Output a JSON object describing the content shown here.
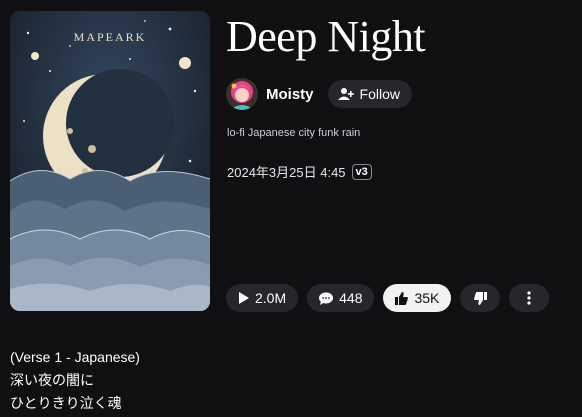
{
  "song": {
    "title": "Deep Night",
    "cover_text": "MAPEARK",
    "artist": "Moisty",
    "follow_label": "Follow",
    "tags": "lo-fi Japanese city funk rain",
    "date": "2024年3月25日 4:45",
    "version": "v3"
  },
  "stats": {
    "plays": "2.0M",
    "comments": "448",
    "likes": "35K",
    "liked": true
  },
  "lyrics": {
    "lines": [
      "(Verse 1 - Japanese)",
      "深い夜の闇に",
      "ひとりきり泣く魂"
    ]
  },
  "icons": {
    "follow": "person-plus-icon",
    "plays": "play-icon",
    "comments": "speech-bubble-icon",
    "likes": "thumbs-up-icon",
    "dislike": "thumbs-down-icon",
    "more": "more-vertical-icon"
  },
  "colors": {
    "background": "#101012",
    "pill": "#26262b",
    "liked_pill": "#f2f2f2"
  }
}
